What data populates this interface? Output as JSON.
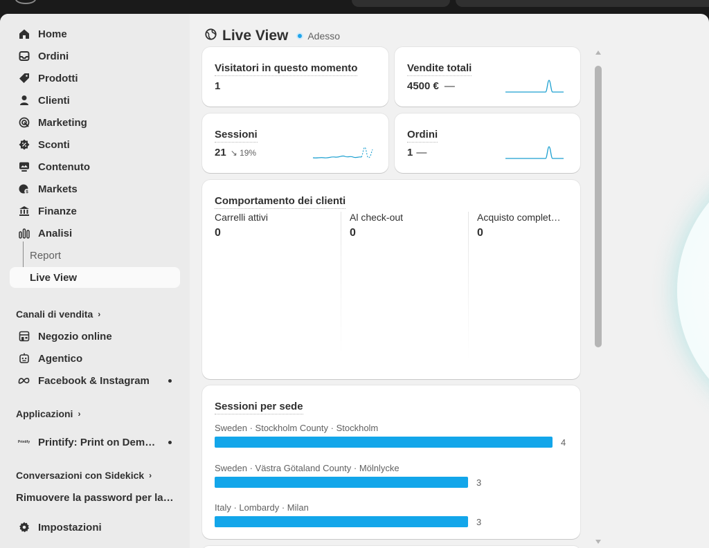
{
  "sidebar": {
    "items": [
      {
        "label": "Home",
        "icon": "home-icon"
      },
      {
        "label": "Ordini",
        "icon": "inbox-icon"
      },
      {
        "label": "Prodotti",
        "icon": "tag-icon"
      },
      {
        "label": "Clienti",
        "icon": "person-icon"
      },
      {
        "label": "Marketing",
        "icon": "target-icon"
      },
      {
        "label": "Sconti",
        "icon": "discount-icon"
      },
      {
        "label": "Contenuto",
        "icon": "content-icon"
      },
      {
        "label": "Markets",
        "icon": "globe-dollar-icon"
      },
      {
        "label": "Finanze",
        "icon": "bank-icon"
      },
      {
        "label": "Analisi",
        "icon": "bar-chart-icon"
      },
      {
        "label": "Report"
      },
      {
        "label": "Live View"
      }
    ],
    "sales_channels": {
      "title": "Canali di vendita",
      "items": [
        {
          "label": "Negozio online",
          "icon": "store-icon"
        },
        {
          "label": "Agentico",
          "icon": "robot-icon"
        },
        {
          "label": "Facebook & Instagram",
          "icon": "meta-icon"
        }
      ]
    },
    "apps": {
      "title": "Applicazioni",
      "items": [
        {
          "label": "Printify: Print on Demand",
          "icon": "printify-icon",
          "icon_text": "Printify"
        }
      ]
    },
    "sidekick": {
      "title": "Conversazioni con Sidekick",
      "items": [
        {
          "label": "Rimuovere la password per lanciare il negozio"
        }
      ]
    },
    "settings": {
      "label": "Impostazioni",
      "icon": "gear-icon"
    }
  },
  "header": {
    "title": "Live View",
    "status": "Adesso",
    "status_color": "#1fa5eb"
  },
  "metrics": {
    "visitors": {
      "title": "Visitatori in questo momento",
      "value": "1"
    },
    "sales": {
      "title": "Vendite totali",
      "value": "4500 €",
      "delta": "—"
    },
    "sessions": {
      "title": "Sessioni",
      "value": "21",
      "delta": "↘ 19%"
    },
    "orders": {
      "title": "Ordini",
      "value": "1",
      "delta": "—"
    }
  },
  "behavior": {
    "title": "Comportamento dei clienti",
    "columns": [
      {
        "label": "Carrelli attivi",
        "value": "0"
      },
      {
        "label": "Al check-out",
        "value": "0"
      },
      {
        "label": "Acquisto completato",
        "value": "0"
      }
    ]
  },
  "locations": {
    "title": "Sessioni per sede",
    "max": 4,
    "bar_color": "#13a6ea",
    "items": [
      {
        "name": "Sweden · Stockholm County · Stockholm",
        "count": 4
      },
      {
        "name": "Sweden · Västra Götaland County · Mölnlycke",
        "count": 3
      },
      {
        "name": "Italy · Lombardy · Milan",
        "count": 3
      }
    ]
  },
  "accent_color": "#1a9fd0"
}
